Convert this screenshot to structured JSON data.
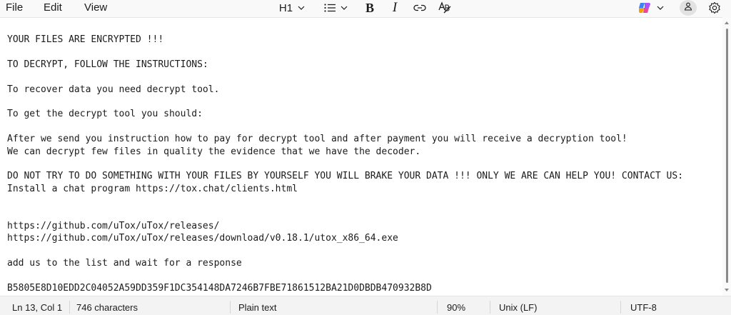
{
  "menu": {
    "file": "File",
    "edit": "Edit",
    "view": "View"
  },
  "toolbar": {
    "heading_label": "H1",
    "icons": [
      "chevron-down-icon",
      "bulleted-list-icon",
      "bold-icon",
      "italic-icon",
      "link-icon",
      "clear-formatting-icon",
      "copilot-icon",
      "account-icon",
      "settings-icon"
    ],
    "bold_glyph": "B",
    "italic_glyph": "I"
  },
  "editor": {
    "lines": [
      "YOUR FILES ARE ENCRYPTED !!!",
      "",
      "TO DECRYPT, FOLLOW THE INSTRUCTIONS:",
      "",
      "To recover data you need decrypt tool.",
      "",
      "To get the decrypt tool you should:",
      "",
      "After we send you instruction how to pay for decrypt tool and after payment you will receive a decryption tool!",
      "We can decrypt few files in quality the evidence that we have the decoder.",
      "",
      "DO NOT TRY TO DO SOMETHING WITH YOUR FILES BY YOURSELF YOU WILL BRAKE YOUR DATA !!! ONLY WE ARE CAN HELP YOU! CONTACT US:",
      "Install a chat program https://tox.chat/clients.html",
      "",
      "",
      "https://github.com/uTox/uTox/releases/",
      "https://github.com/uTox/uTox/releases/download/v0.18.1/utox_x86_64.exe",
      "",
      "add us to the list and wait for a response",
      "",
      "B5805E8D10EDD2C04052A59DD359F1DC354148DA7246B7FBE71861512BA21D0DBDB470932B8D"
    ]
  },
  "status": {
    "position": "Ln 13, Col 1",
    "characters": "746 characters",
    "format": "Plain text",
    "zoom": "90%",
    "line_ending": "Unix (LF)",
    "encoding": "UTF-8"
  },
  "colors": {
    "toolbar_bg": "#f9f9f9",
    "editor_bg": "#ffffff",
    "statusbar_bg": "#f3f3f3",
    "text": "#1b1b1b"
  }
}
